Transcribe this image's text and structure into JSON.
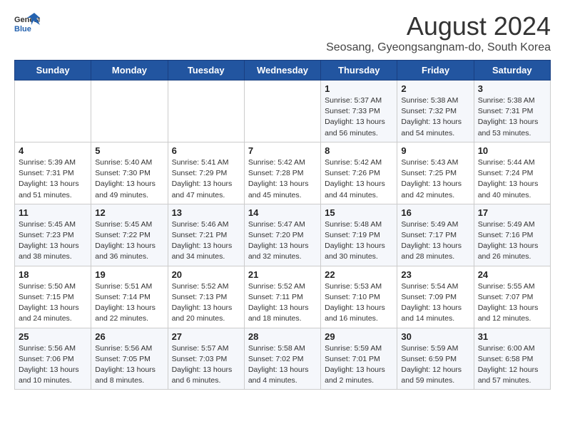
{
  "logo": {
    "general": "General",
    "blue": "Blue"
  },
  "title": {
    "month": "August 2024",
    "location": "Seosang, Gyeongsangnam-do, South Korea"
  },
  "weekdays": [
    "Sunday",
    "Monday",
    "Tuesday",
    "Wednesday",
    "Thursday",
    "Friday",
    "Saturday"
  ],
  "weeks": [
    [
      {
        "day": "",
        "info": ""
      },
      {
        "day": "",
        "info": ""
      },
      {
        "day": "",
        "info": ""
      },
      {
        "day": "",
        "info": ""
      },
      {
        "day": "1",
        "info": "Sunrise: 5:37 AM\nSunset: 7:33 PM\nDaylight: 13 hours\nand 56 minutes."
      },
      {
        "day": "2",
        "info": "Sunrise: 5:38 AM\nSunset: 7:32 PM\nDaylight: 13 hours\nand 54 minutes."
      },
      {
        "day": "3",
        "info": "Sunrise: 5:38 AM\nSunset: 7:31 PM\nDaylight: 13 hours\nand 53 minutes."
      }
    ],
    [
      {
        "day": "4",
        "info": "Sunrise: 5:39 AM\nSunset: 7:31 PM\nDaylight: 13 hours\nand 51 minutes."
      },
      {
        "day": "5",
        "info": "Sunrise: 5:40 AM\nSunset: 7:30 PM\nDaylight: 13 hours\nand 49 minutes."
      },
      {
        "day": "6",
        "info": "Sunrise: 5:41 AM\nSunset: 7:29 PM\nDaylight: 13 hours\nand 47 minutes."
      },
      {
        "day": "7",
        "info": "Sunrise: 5:42 AM\nSunset: 7:28 PM\nDaylight: 13 hours\nand 45 minutes."
      },
      {
        "day": "8",
        "info": "Sunrise: 5:42 AM\nSunset: 7:26 PM\nDaylight: 13 hours\nand 44 minutes."
      },
      {
        "day": "9",
        "info": "Sunrise: 5:43 AM\nSunset: 7:25 PM\nDaylight: 13 hours\nand 42 minutes."
      },
      {
        "day": "10",
        "info": "Sunrise: 5:44 AM\nSunset: 7:24 PM\nDaylight: 13 hours\nand 40 minutes."
      }
    ],
    [
      {
        "day": "11",
        "info": "Sunrise: 5:45 AM\nSunset: 7:23 PM\nDaylight: 13 hours\nand 38 minutes."
      },
      {
        "day": "12",
        "info": "Sunrise: 5:45 AM\nSunset: 7:22 PM\nDaylight: 13 hours\nand 36 minutes."
      },
      {
        "day": "13",
        "info": "Sunrise: 5:46 AM\nSunset: 7:21 PM\nDaylight: 13 hours\nand 34 minutes."
      },
      {
        "day": "14",
        "info": "Sunrise: 5:47 AM\nSunset: 7:20 PM\nDaylight: 13 hours\nand 32 minutes."
      },
      {
        "day": "15",
        "info": "Sunrise: 5:48 AM\nSunset: 7:19 PM\nDaylight: 13 hours\nand 30 minutes."
      },
      {
        "day": "16",
        "info": "Sunrise: 5:49 AM\nSunset: 7:17 PM\nDaylight: 13 hours\nand 28 minutes."
      },
      {
        "day": "17",
        "info": "Sunrise: 5:49 AM\nSunset: 7:16 PM\nDaylight: 13 hours\nand 26 minutes."
      }
    ],
    [
      {
        "day": "18",
        "info": "Sunrise: 5:50 AM\nSunset: 7:15 PM\nDaylight: 13 hours\nand 24 minutes."
      },
      {
        "day": "19",
        "info": "Sunrise: 5:51 AM\nSunset: 7:14 PM\nDaylight: 13 hours\nand 22 minutes."
      },
      {
        "day": "20",
        "info": "Sunrise: 5:52 AM\nSunset: 7:13 PM\nDaylight: 13 hours\nand 20 minutes."
      },
      {
        "day": "21",
        "info": "Sunrise: 5:52 AM\nSunset: 7:11 PM\nDaylight: 13 hours\nand 18 minutes."
      },
      {
        "day": "22",
        "info": "Sunrise: 5:53 AM\nSunset: 7:10 PM\nDaylight: 13 hours\nand 16 minutes."
      },
      {
        "day": "23",
        "info": "Sunrise: 5:54 AM\nSunset: 7:09 PM\nDaylight: 13 hours\nand 14 minutes."
      },
      {
        "day": "24",
        "info": "Sunrise: 5:55 AM\nSunset: 7:07 PM\nDaylight: 13 hours\nand 12 minutes."
      }
    ],
    [
      {
        "day": "25",
        "info": "Sunrise: 5:56 AM\nSunset: 7:06 PM\nDaylight: 13 hours\nand 10 minutes."
      },
      {
        "day": "26",
        "info": "Sunrise: 5:56 AM\nSunset: 7:05 PM\nDaylight: 13 hours\nand 8 minutes."
      },
      {
        "day": "27",
        "info": "Sunrise: 5:57 AM\nSunset: 7:03 PM\nDaylight: 13 hours\nand 6 minutes."
      },
      {
        "day": "28",
        "info": "Sunrise: 5:58 AM\nSunset: 7:02 PM\nDaylight: 13 hours\nand 4 minutes."
      },
      {
        "day": "29",
        "info": "Sunrise: 5:59 AM\nSunset: 7:01 PM\nDaylight: 13 hours\nand 2 minutes."
      },
      {
        "day": "30",
        "info": "Sunrise: 5:59 AM\nSunset: 6:59 PM\nDaylight: 12 hours\nand 59 minutes."
      },
      {
        "day": "31",
        "info": "Sunrise: 6:00 AM\nSunset: 6:58 PM\nDaylight: 12 hours\nand 57 minutes."
      }
    ]
  ]
}
